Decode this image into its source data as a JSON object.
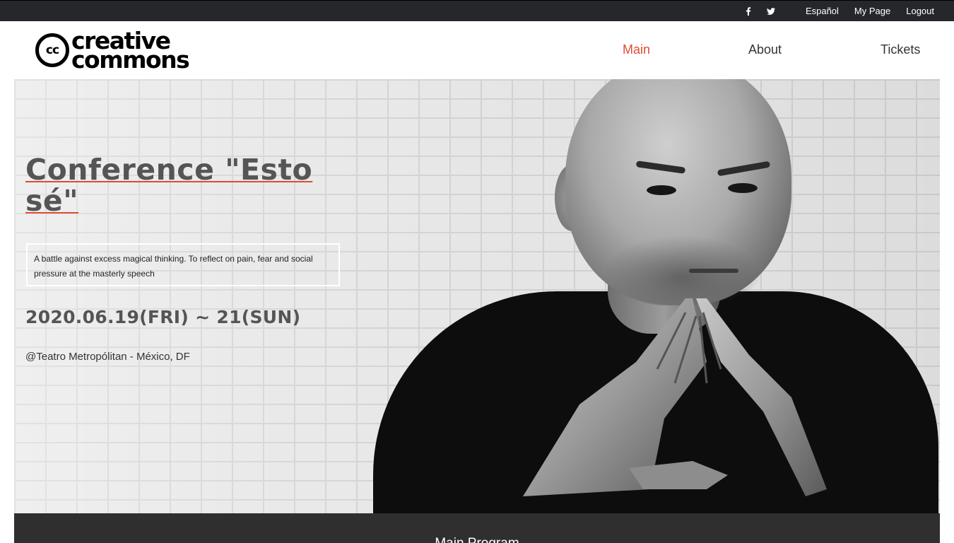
{
  "topbar": {
    "social": [
      "facebook-icon",
      "twitter-icon"
    ],
    "links": [
      "Español",
      "My Page",
      "Logout"
    ]
  },
  "header": {
    "logo": {
      "badge": "cc",
      "line1": "creative",
      "line2": "commons"
    },
    "nav": [
      {
        "label": "Main",
        "active": true
      },
      {
        "label": "About",
        "active": false
      },
      {
        "label": "Tickets",
        "active": false
      }
    ],
    "accent_color": "#e04a35"
  },
  "hero": {
    "title_line1": "Conference \"Esto",
    "title_line2": "sé\"",
    "description": "A battle against excess magical thinking. To reflect on pain, fear and social pressure at the masterly speech",
    "dates": "2020.06.19(FRI) ~ 21(SUN)",
    "venue": "@Teatro Metropólitan - México, DF"
  },
  "program": {
    "label": "Main Program"
  }
}
